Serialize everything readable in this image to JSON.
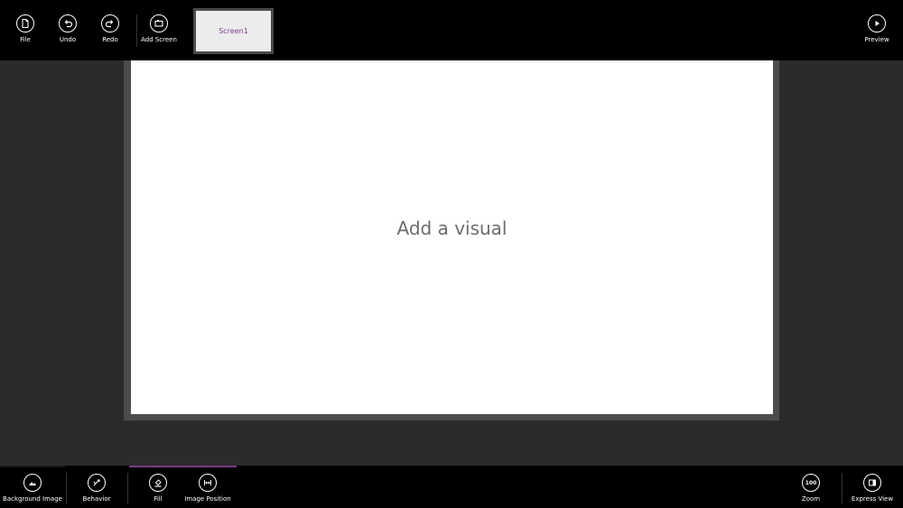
{
  "topbar": {
    "file": {
      "label": "File",
      "icon": "file-icon"
    },
    "undo": {
      "label": "Undo",
      "icon": "undo-icon"
    },
    "redo": {
      "label": "Redo",
      "icon": "redo-icon"
    },
    "add_screen": {
      "label": "Add Screen",
      "icon": "add-screen-icon"
    },
    "preview": {
      "label": "Preview",
      "icon": "play-icon"
    }
  },
  "screens": [
    {
      "label": "Screen1",
      "selected": true
    }
  ],
  "canvas": {
    "placeholder": "Add a visual"
  },
  "bottombar": {
    "background_image": {
      "label": "Background Image",
      "icon": "image-icon"
    },
    "behavior": {
      "label": "Behavior",
      "icon": "behavior-icon"
    },
    "fill": {
      "label": "Fill",
      "icon": "fill-icon"
    },
    "image_position": {
      "label": "Image Position",
      "icon": "image-position-icon"
    },
    "zoom": {
      "label": "Zoom",
      "value": "100"
    },
    "express_view": {
      "label": "Express View",
      "icon": "express-view-icon"
    }
  },
  "colors": {
    "accent": "#7a3a8c",
    "topbar_bg": "#000000",
    "workspace_bg": "#2b2b2b"
  }
}
